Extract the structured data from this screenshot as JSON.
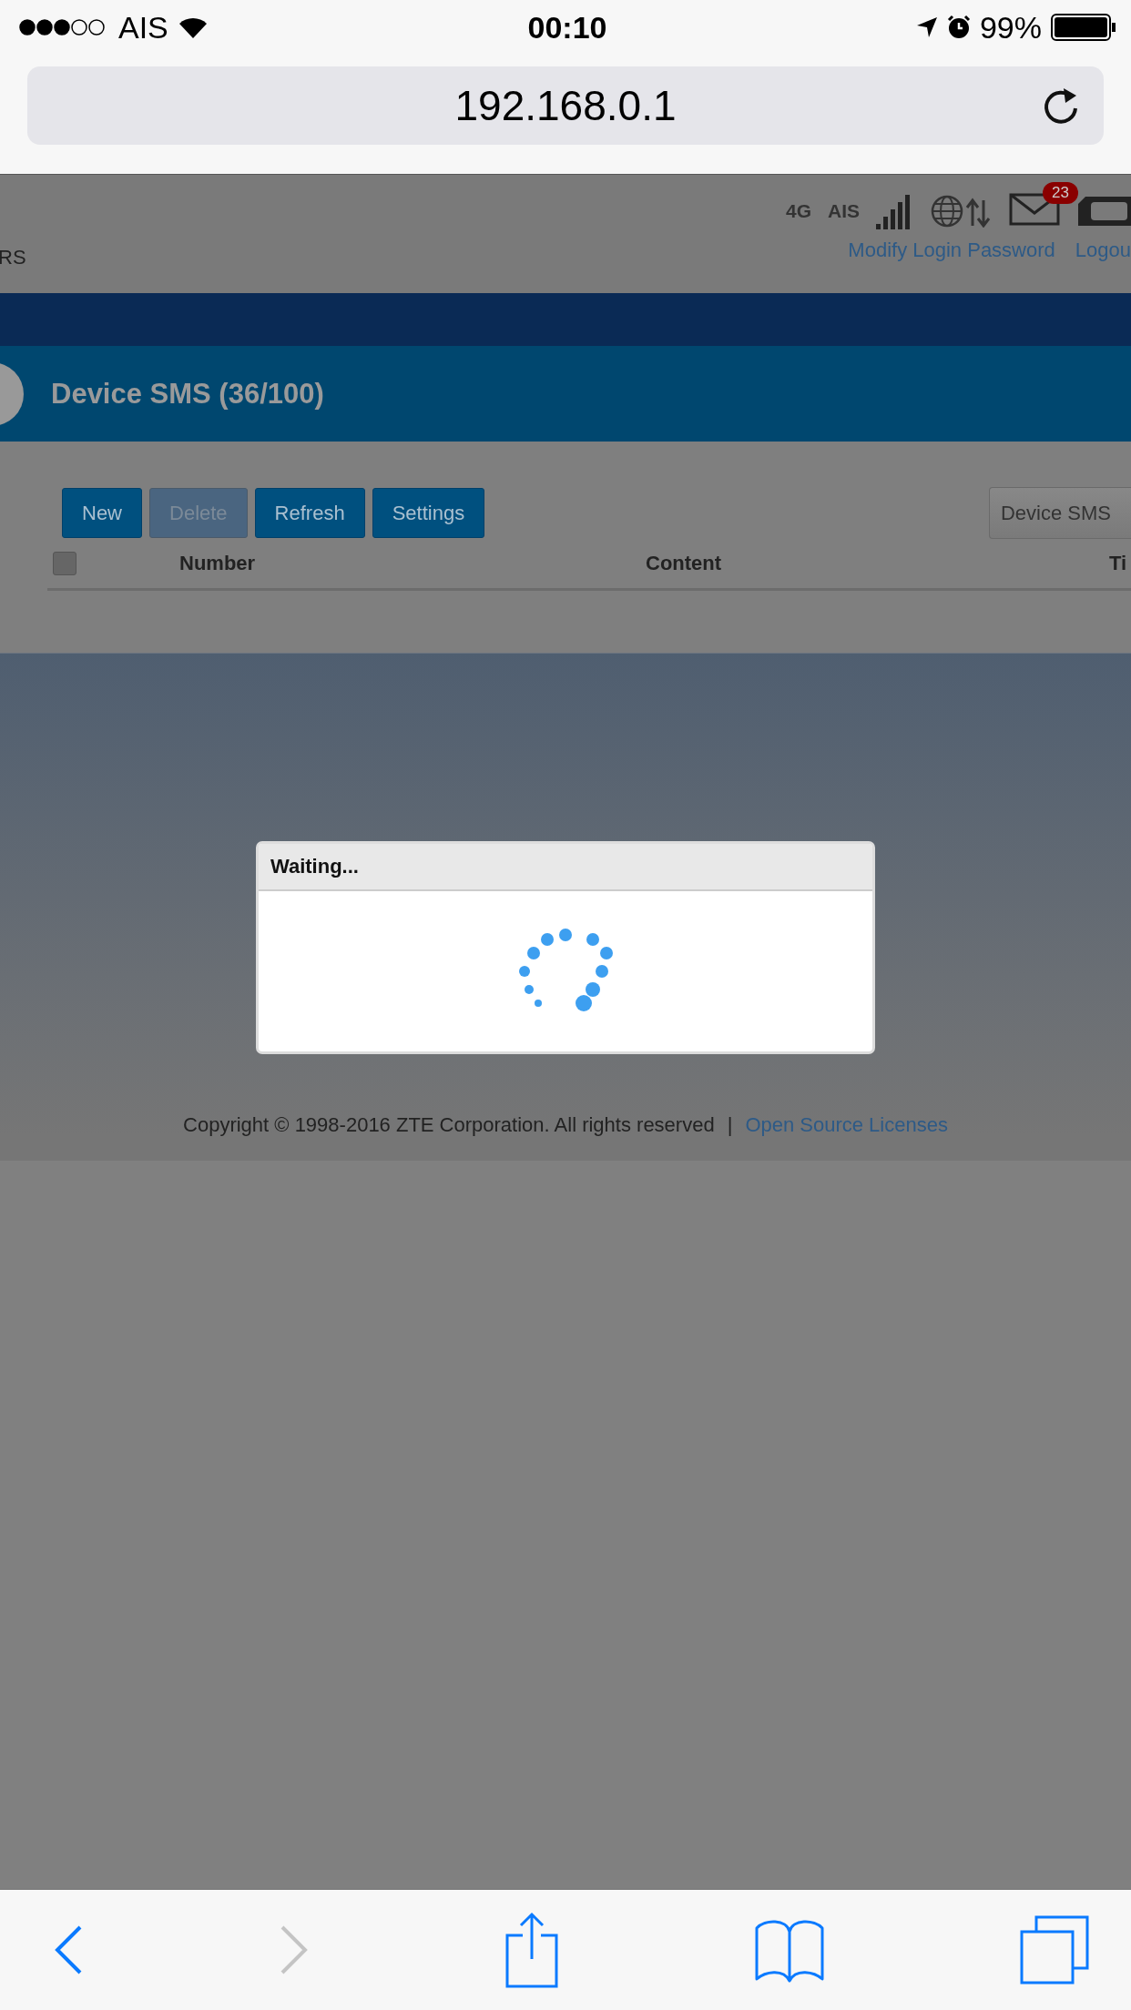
{
  "status_bar": {
    "carrier": "AIS",
    "time": "00:10",
    "battery": "99%"
  },
  "browser": {
    "url": "192.168.0.1"
  },
  "header": {
    "left_text": "RS",
    "network_type": "4G",
    "operator": "AIS",
    "message_badge": "23",
    "links": [
      "Modify Login Password",
      "Logou"
    ]
  },
  "page_title": "Device SMS (36/100)",
  "toolbar": [
    {
      "label": "New",
      "disabled": false
    },
    {
      "label": "Delete",
      "disabled": true
    },
    {
      "label": "Refresh",
      "disabled": false
    },
    {
      "label": "Settings",
      "disabled": false
    }
  ],
  "sms_select": {
    "value": "Device SMS"
  },
  "table": {
    "select_all_checked": false,
    "columns": [
      "Number",
      "Content",
      "Ti"
    ]
  },
  "dialog": {
    "title": "Waiting..."
  },
  "footer": {
    "copyright": "Copyright © 1998-2016 ZTE Corporation. All rights reserved",
    "separator": "|",
    "link": "Open Source Licenses"
  }
}
